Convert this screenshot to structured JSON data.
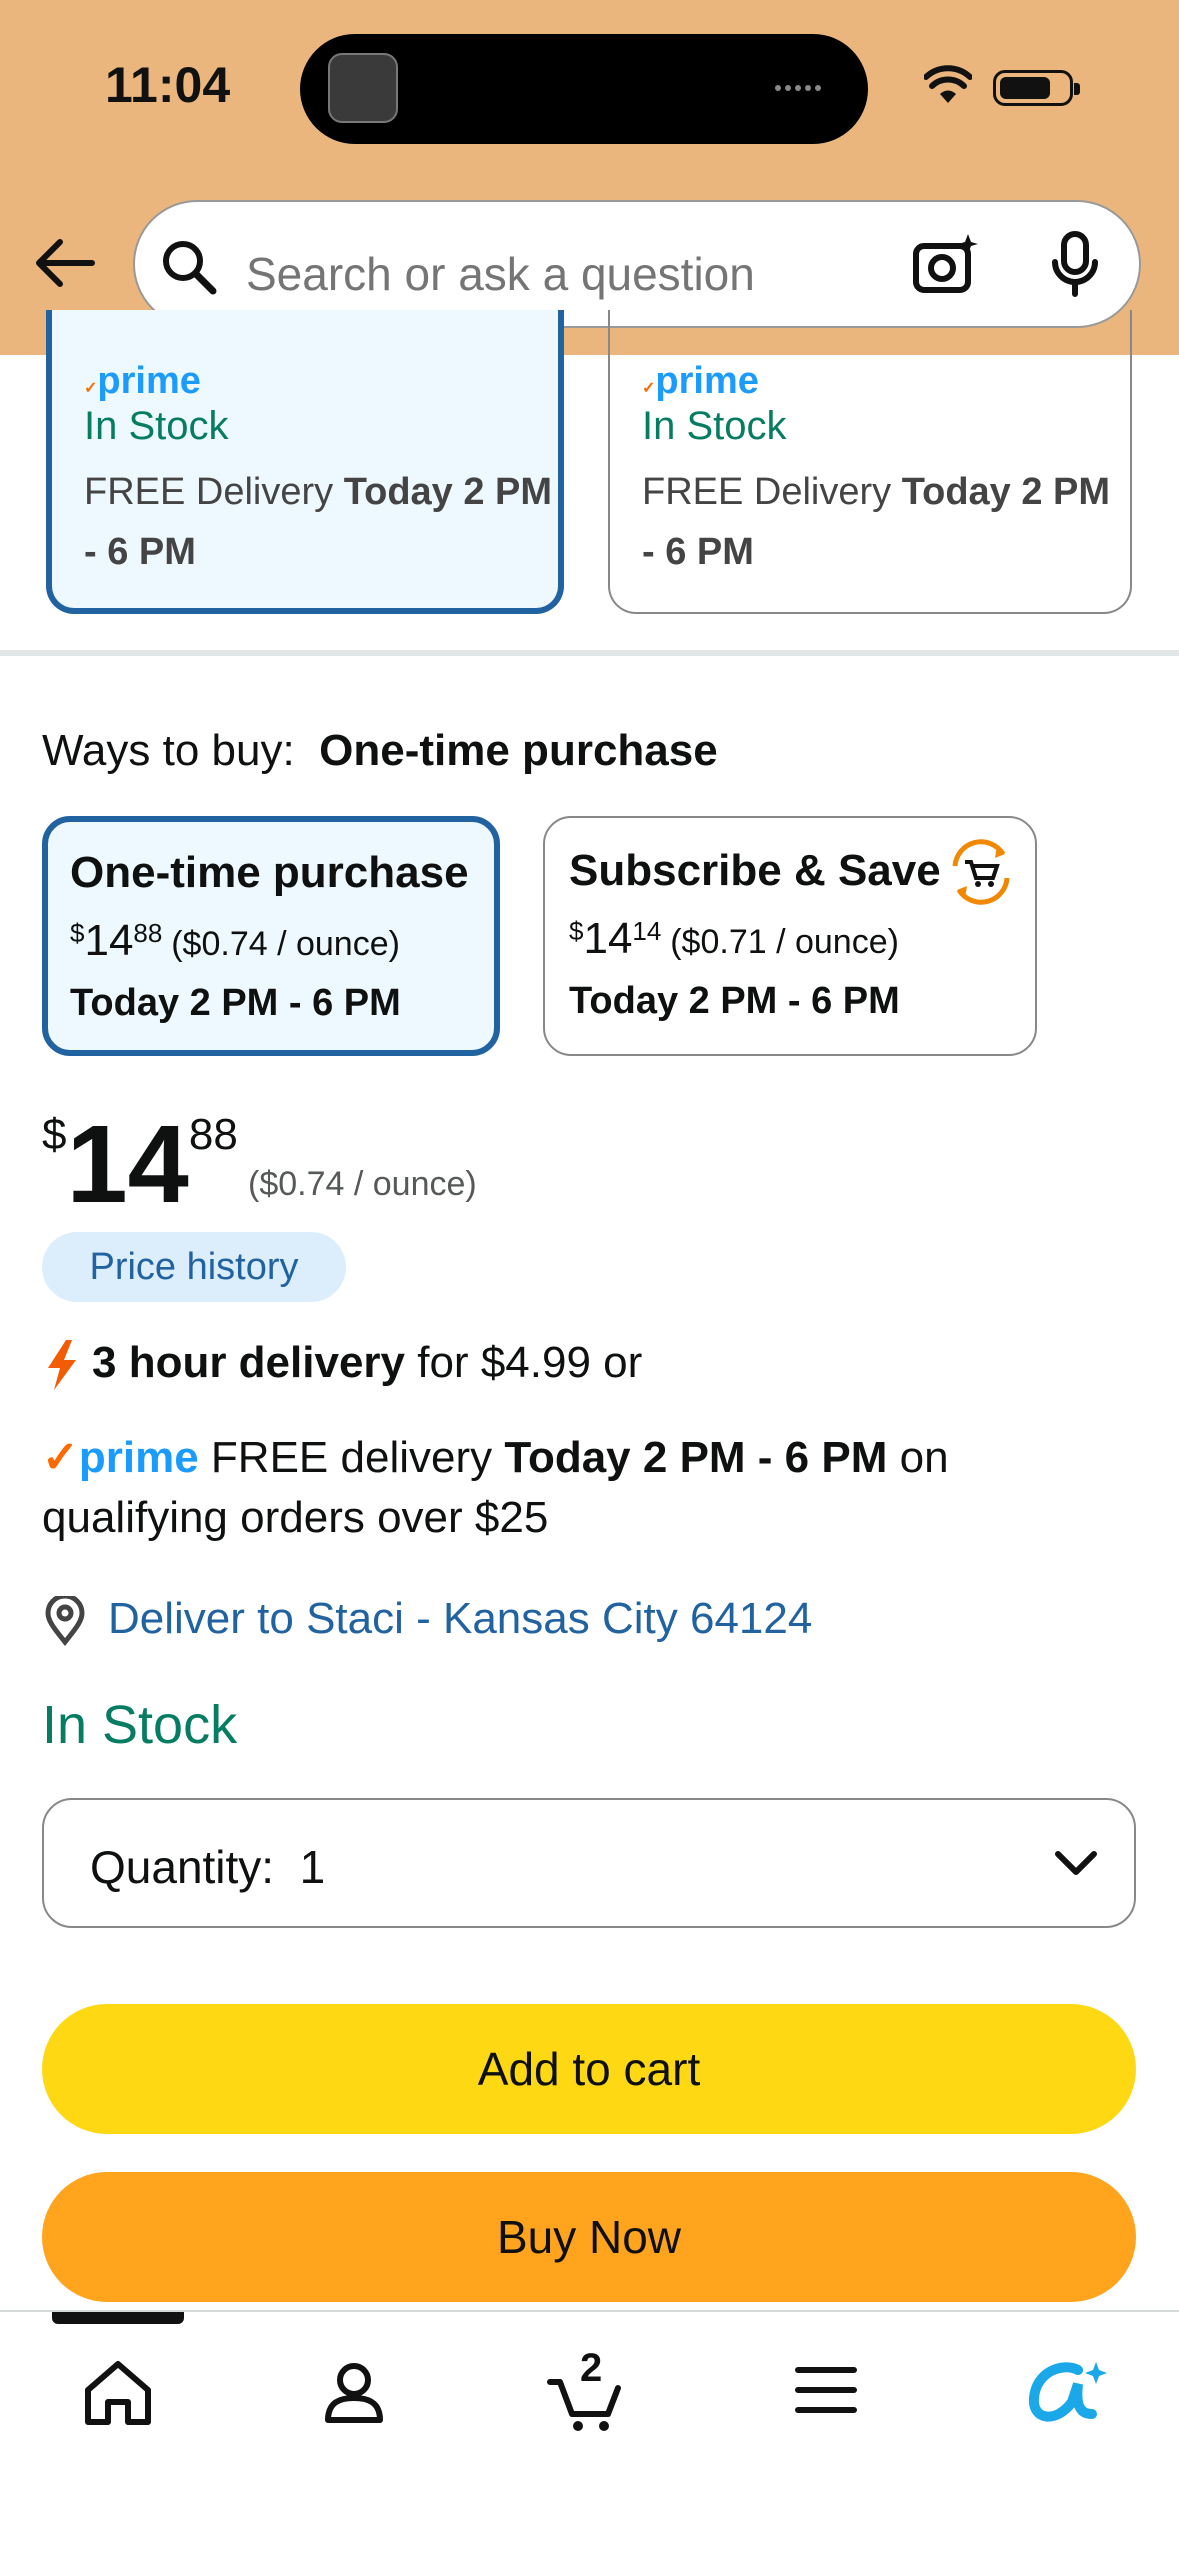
{
  "status": {
    "time": "11:04"
  },
  "search": {
    "placeholder": "Search or ask a question"
  },
  "delivery_cards": [
    {
      "prime": "prime",
      "stock": "In Stock",
      "delivery_prefix": "FREE Delivery ",
      "delivery_time": "Today 2 PM - 6 PM"
    },
    {
      "prime": "prime",
      "stock": "In Stock",
      "delivery_prefix": "FREE Delivery ",
      "delivery_time": "Today 2 PM - 6 PM"
    }
  ],
  "ways_to_buy": {
    "label": "Ways to buy:",
    "selected": "One-time purchase"
  },
  "options": [
    {
      "title": "One-time purchase",
      "dollar": "$",
      "whole": "14",
      "cents": "88",
      "unit": "($0.74 / ounce)",
      "day": "Today 2 PM - 6 PM"
    },
    {
      "title": "Subscribe & Save",
      "dollar": "$",
      "whole": "14",
      "cents": "14",
      "unit": "($0.71 / ounce)",
      "day": "Today 2 PM - 6 PM"
    }
  ],
  "price": {
    "dollar": "$",
    "whole": "14",
    "cents": "88",
    "unit": "($0.74 / ounce)"
  },
  "price_history": "Price history",
  "fast_delivery": {
    "bold": "3 hour delivery",
    "rest": " for $4.99 or"
  },
  "prime_line": {
    "prime": "prime",
    "pre": " FREE delivery ",
    "bold": "Today 2 PM - 6 PM",
    "post": " on qualifying orders over $25"
  },
  "deliver_to": "Deliver to Staci - Kansas City 64124",
  "stock": "In Stock",
  "quantity": {
    "label": "Quantity:",
    "value": "1"
  },
  "buttons": {
    "add_to_cart": "Add to cart",
    "buy_now": "Buy Now"
  },
  "tabbar": {
    "cart_count": "2"
  },
  "colors": {
    "header": "#ebb67d",
    "link": "#2162a1",
    "stock": "#067d62",
    "add_to_cart": "#ffd814",
    "buy_now": "#ffa41c",
    "prime": "#1b9cfc"
  }
}
